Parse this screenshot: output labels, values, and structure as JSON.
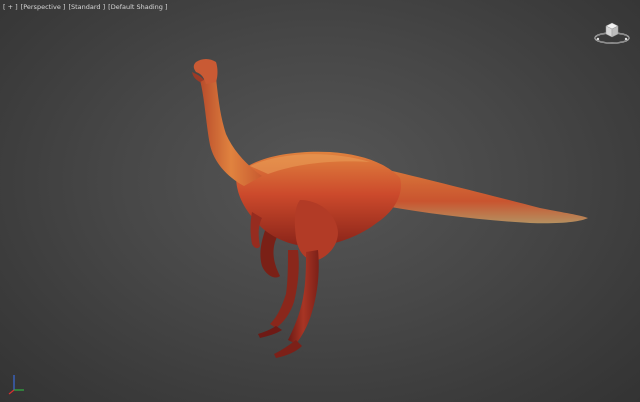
{
  "viewport": {
    "labels": {
      "plus": "[ + ]",
      "view": "[Perspective ]",
      "style": "[Standard ]",
      "shading": "[Default Shading ]"
    },
    "background_color": "#474747",
    "label_color": "#d8d8d8"
  },
  "icons": {
    "viewcube": "viewcube-icon",
    "axis_tripod": "axis-tripod-icon"
  },
  "model": {
    "subject": "ostrich-like dinosaur",
    "colors": {
      "skin_primary": "#c8442a",
      "skin_highlight": "#e07a3c",
      "skin_shadow": "#7a1f18",
      "belly_tint": "#d9a25a"
    }
  }
}
